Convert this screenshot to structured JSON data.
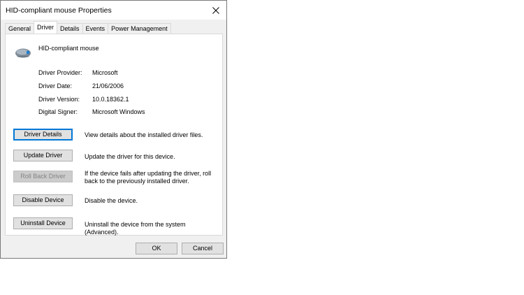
{
  "window": {
    "title": "HID-compliant mouse Properties"
  },
  "tabs": [
    {
      "label": "General"
    },
    {
      "label": "Driver"
    },
    {
      "label": "Details"
    },
    {
      "label": "Events"
    },
    {
      "label": "Power Management"
    }
  ],
  "active_tab": "Driver",
  "device": {
    "name": "HID-compliant mouse",
    "icon": "mouse-icon"
  },
  "properties": [
    {
      "label": "Driver Provider:",
      "value": "Microsoft"
    },
    {
      "label": "Driver Date:",
      "value": "21/06/2006"
    },
    {
      "label": "Driver Version:",
      "value": "10.0.18362.1"
    },
    {
      "label": "Digital Signer:",
      "value": "Microsoft Windows"
    }
  ],
  "actions": [
    {
      "label": "Driver Details",
      "description": "View details about the installed driver files.",
      "enabled": true
    },
    {
      "label": "Update Driver",
      "description": "Update the driver for this device.",
      "enabled": true
    },
    {
      "label": "Roll Back Driver",
      "description": "If the device fails after updating the driver, roll back to the previously installed driver.",
      "enabled": false
    },
    {
      "label": "Disable Device",
      "description": "Disable the device.",
      "enabled": true
    },
    {
      "label": "Uninstall Device",
      "description": "Uninstall the device from the system (Advanced).",
      "enabled": true
    }
  ],
  "footer": {
    "ok_label": "OK",
    "cancel_label": "Cancel"
  }
}
